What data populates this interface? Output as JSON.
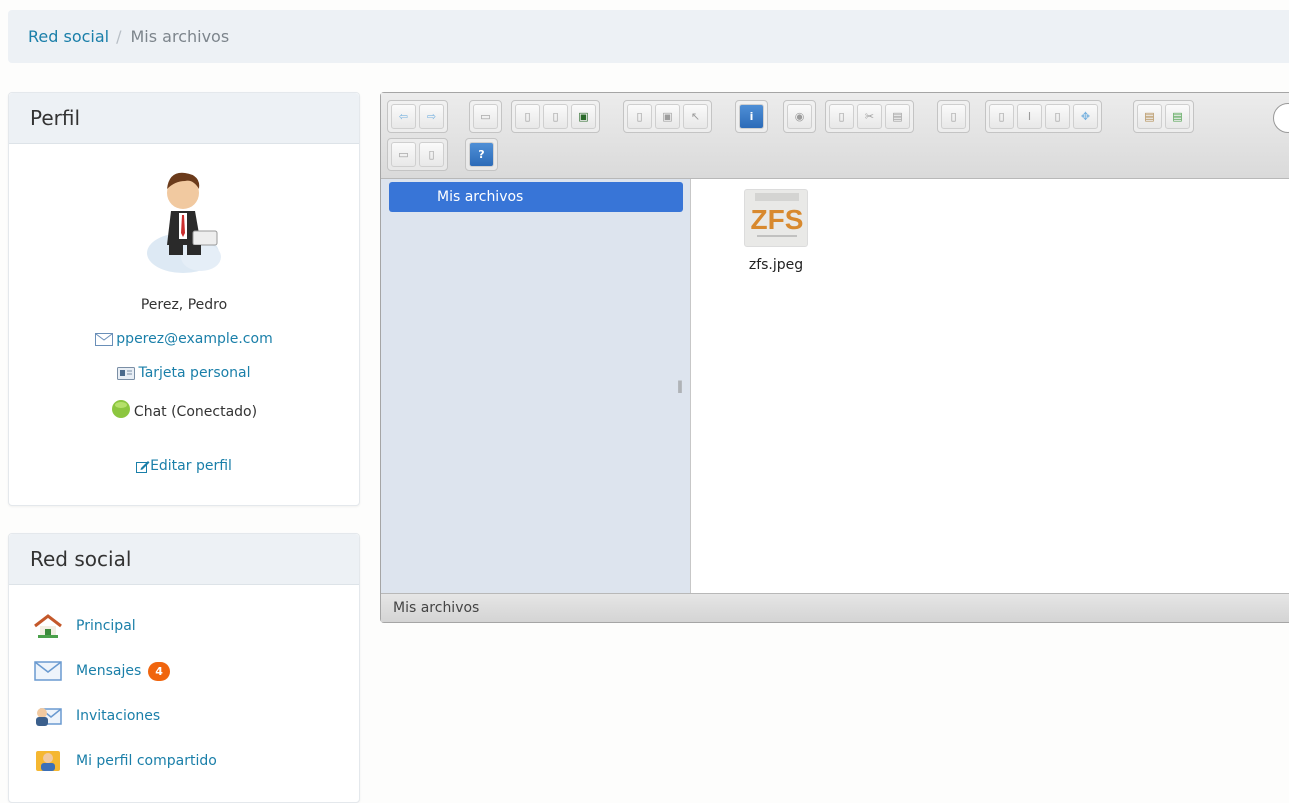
{
  "breadcrumb": {
    "home": "Red social",
    "separator": "/",
    "current": "Mis archivos"
  },
  "profile": {
    "heading": "Perfil",
    "name": "Perez, Pedro",
    "email": "pperez@example.com",
    "card": "Tarjeta personal",
    "chat": "Chat (Conectado)",
    "edit": "Editar perfil"
  },
  "social": {
    "heading": "Red social",
    "items": [
      {
        "label": "Principal",
        "icon": "home-icon"
      },
      {
        "label": "Mensajes",
        "icon": "envelope-icon",
        "badge": "4"
      },
      {
        "label": "Invitaciones",
        "icon": "invitation-icon"
      },
      {
        "label": "Mi perfil compartido",
        "icon": "shared-profile-icon"
      }
    ]
  },
  "file_manager": {
    "folder": "Mis archivos",
    "files": [
      {
        "name": "zfs.jpeg",
        "thumb_text": "ZFS"
      }
    ],
    "status": "Mis archivos",
    "info_icon": "i",
    "help_icon": "?"
  },
  "colors": {
    "accent": "#3875d7",
    "link": "#1a7fa9",
    "badge": "#f0650e",
    "chat_online": "#8cc63f"
  }
}
